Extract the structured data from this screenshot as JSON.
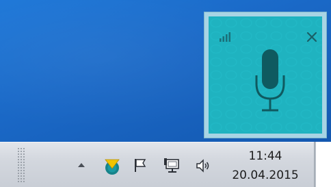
{
  "tray": {
    "time": "11:44",
    "date": "20.04.2015",
    "icons": [
      "show-hidden-icons-arrow",
      "antivirus-icon",
      "action-center-flag-icon",
      "network-icon",
      "volume-icon"
    ]
  },
  "popup": {
    "icons": [
      "signal-strength-icon",
      "close-icon",
      "microphone-icon"
    ]
  },
  "colors": {
    "popup_bg": "#1fb3c0",
    "popup_border": "#a8d4e4",
    "desktop_bg": "#1a68c6",
    "taskbar_bg": "#d3d7de"
  }
}
